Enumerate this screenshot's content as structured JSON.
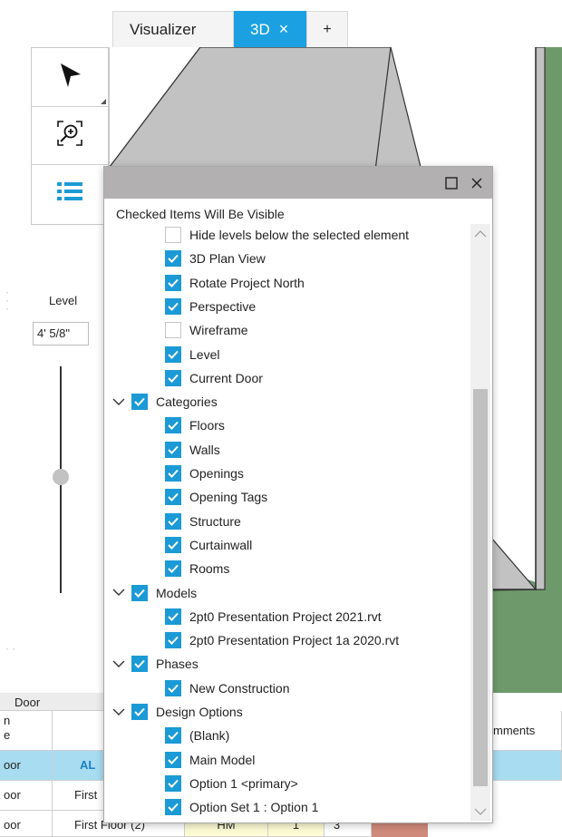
{
  "tabs": {
    "visualizer": "Visualizer",
    "active": "3D",
    "close_glyph": "×",
    "add": "+"
  },
  "tools": [
    {
      "name": "select-arrow-icon"
    },
    {
      "name": "zoom-fit-icon"
    },
    {
      "name": "list-icon"
    }
  ],
  "level": {
    "label": "Level",
    "value": "4' 5/8\""
  },
  "dialog": {
    "title": "Checked Items Will Be Visible",
    "rows": [
      {
        "label": "Hide levels below the selected element",
        "checked": false,
        "indent": 1
      },
      {
        "label": "3D Plan View",
        "checked": true,
        "indent": 1
      },
      {
        "label": "Rotate Project North",
        "checked": true,
        "indent": 1
      },
      {
        "label": "Perspective",
        "checked": true,
        "indent": 1
      },
      {
        "label": "Wireframe",
        "checked": false,
        "indent": 1
      },
      {
        "label": "Level",
        "checked": true,
        "indent": 1
      },
      {
        "label": "Current Door",
        "checked": true,
        "indent": 1
      },
      {
        "label": "Categories",
        "checked": true,
        "indent": 0,
        "expandable": true
      },
      {
        "label": "Floors",
        "checked": true,
        "indent": 1
      },
      {
        "label": "Walls",
        "checked": true,
        "indent": 1
      },
      {
        "label": "Openings",
        "checked": true,
        "indent": 1
      },
      {
        "label": "Opening Tags",
        "checked": true,
        "indent": 1
      },
      {
        "label": "Structure",
        "checked": true,
        "indent": 1
      },
      {
        "label": "Curtainwall",
        "checked": true,
        "indent": 1
      },
      {
        "label": "Rooms",
        "checked": true,
        "indent": 1
      },
      {
        "label": "Models",
        "checked": true,
        "indent": 0,
        "expandable": true
      },
      {
        "label": "2pt0 Presentation Project 2021.rvt",
        "checked": true,
        "indent": 1
      },
      {
        "label": "2pt0 Presentation Project 1a 2020.rvt",
        "checked": true,
        "indent": 1
      },
      {
        "label": "Phases",
        "checked": true,
        "indent": 0,
        "expandable": true
      },
      {
        "label": "New Construction",
        "checked": true,
        "indent": 1
      },
      {
        "label": "Design Options",
        "checked": true,
        "indent": 0,
        "expandable": true
      },
      {
        "label": "(Blank)",
        "checked": true,
        "indent": 1
      },
      {
        "label": "Main Model",
        "checked": true,
        "indent": 1
      },
      {
        "label": "Option 1  <primary>",
        "checked": true,
        "indent": 1
      },
      {
        "label": "Option Set 1 : Option 1",
        "checked": true,
        "indent": 1
      }
    ]
  },
  "table": {
    "group_header": "Door",
    "col_header_a_line1": "n",
    "col_header_a_line2": "e",
    "col_header_comments": "mments",
    "rows": [
      {
        "a": "oor",
        "b": "AL",
        "highlight": true
      },
      {
        "a": "oor",
        "b": "First"
      },
      {
        "a": "oor",
        "b": "First Floor (2)",
        "c": "HM",
        "d": "1",
        "e": "3"
      }
    ]
  },
  "colors": {
    "accent": "#1ba1e2",
    "checkbox": "#1b9ad6",
    "model_green": "#6e9a6b",
    "model_gray": "#c2c2c2",
    "row_highlight": "#a8dcf0",
    "swatch_red": "#d08a7c",
    "swatch_yellow": "#fdfbd4"
  }
}
